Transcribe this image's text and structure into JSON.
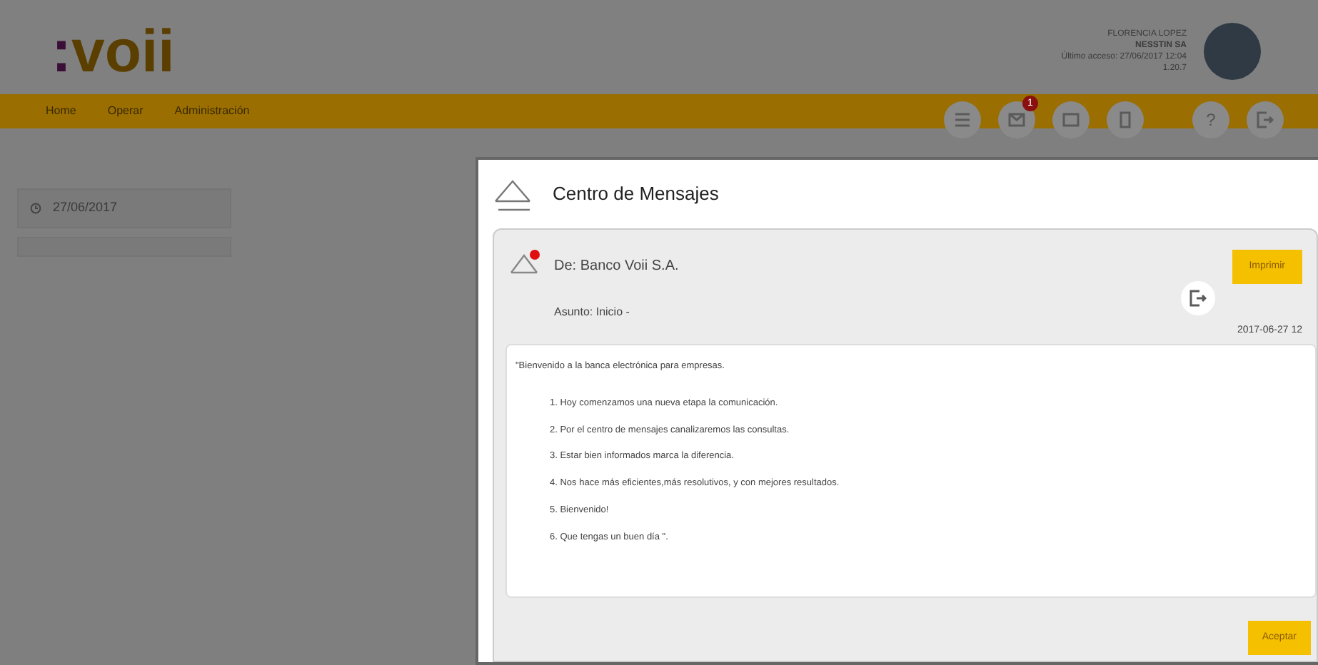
{
  "header": {
    "logo": ":voii",
    "user": {
      "name": "FLORENCIA LOPEZ",
      "company": "NESSTIN SA",
      "last_access": "Último acceso: 27/06/2017 12:04",
      "version": "1.20.7"
    }
  },
  "nav": {
    "items": [
      {
        "label": "Home"
      },
      {
        "label": "Operar"
      },
      {
        "label": "Administración"
      }
    ],
    "tools": [
      {
        "kind": "icon"
      },
      {
        "kind": "icon",
        "badge": "1"
      },
      {
        "kind": "icon"
      },
      {
        "kind": "icon"
      },
      {
        "kind": "text",
        "label": "?"
      },
      {
        "kind": "icon"
      }
    ]
  },
  "sidebar": {
    "date": "27/06/2017"
  },
  "modal": {
    "title": "Centro de Mensajes",
    "message": {
      "from": "De: Banco Voii S.A.",
      "subject": "Asunto: Inicio -",
      "date": "2017-06-27 12",
      "unread": true,
      "intro": "\"Bienvenido a la banca electrónica para empresas.",
      "lines": [
        "1. Hoy comenzamos una nueva etapa la comunicación.",
        "2. Por el centro de mensajes canalizaremos las consultas.",
        "3. Estar bien informados marca la diferencia.",
        "4. Nos hace más eficientes,más resolutivos, y con mejores resultados.",
        "5. Bienvenido!",
        "6. Que tengas un buen día \"."
      ]
    },
    "buttons": [
      {
        "kind": "print",
        "label": "Imprimir"
      },
      {
        "kind": "accept",
        "label": "Aceptar"
      }
    ]
  }
}
